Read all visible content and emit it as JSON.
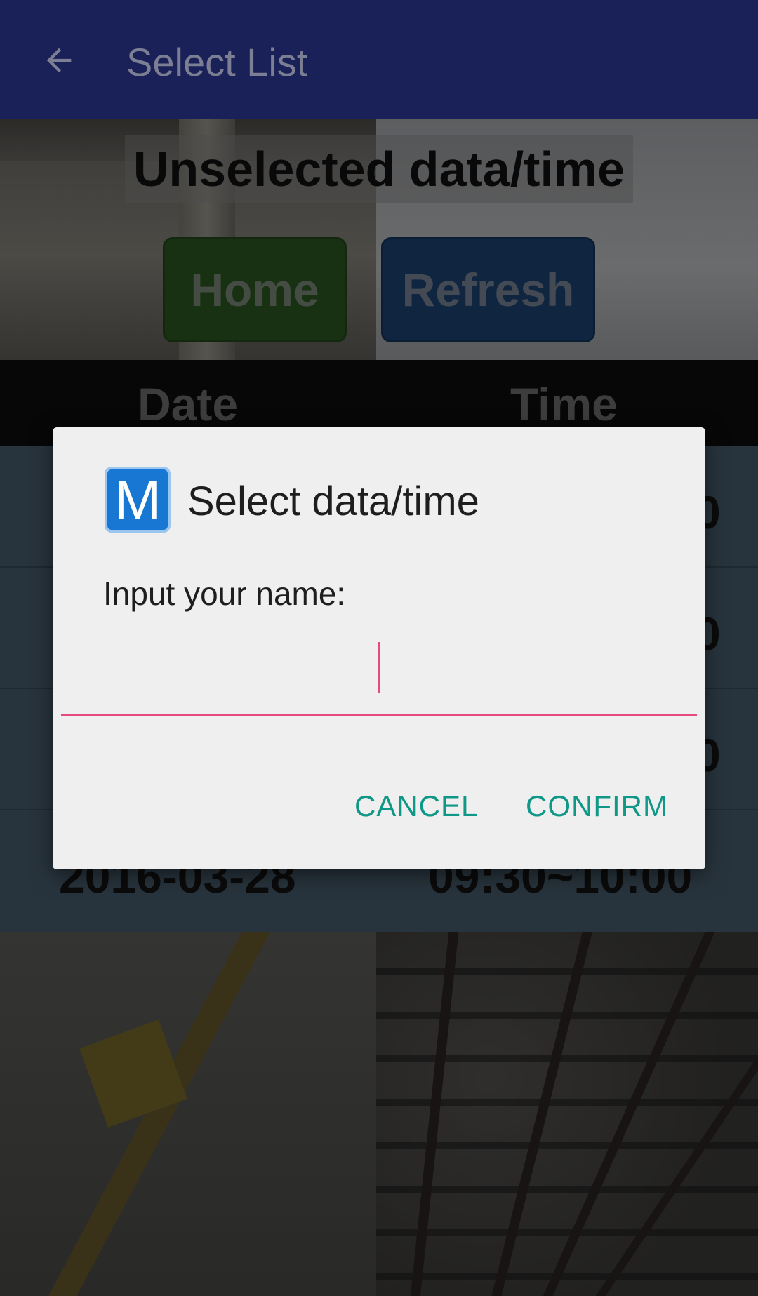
{
  "appbar": {
    "title": "Select List",
    "back_icon": "arrow-left-icon",
    "background": "#1a2058"
  },
  "headline": "Unselected data/time",
  "buttons": {
    "home": "Home",
    "refresh": "Refresh"
  },
  "table": {
    "headers": {
      "date": "Date",
      "time": "Time"
    },
    "rows": [
      {
        "date": "",
        "time": "",
        "edge": "0"
      },
      {
        "date": "",
        "time": "",
        "edge": "0"
      },
      {
        "date": "",
        "time": "",
        "edge": "0"
      },
      {
        "date": "2016-03-28",
        "time": "09:30~10:00",
        "edge": ""
      }
    ]
  },
  "dialog": {
    "icon_letter": "M",
    "icon": "app-m-icon",
    "title": "Select data/time",
    "message": "Input your name:",
    "input_value": "",
    "cancel_label": "CANCEL",
    "confirm_label": "CONFIRM",
    "accent": "#e84a7d",
    "button_color": "#0f9787"
  }
}
